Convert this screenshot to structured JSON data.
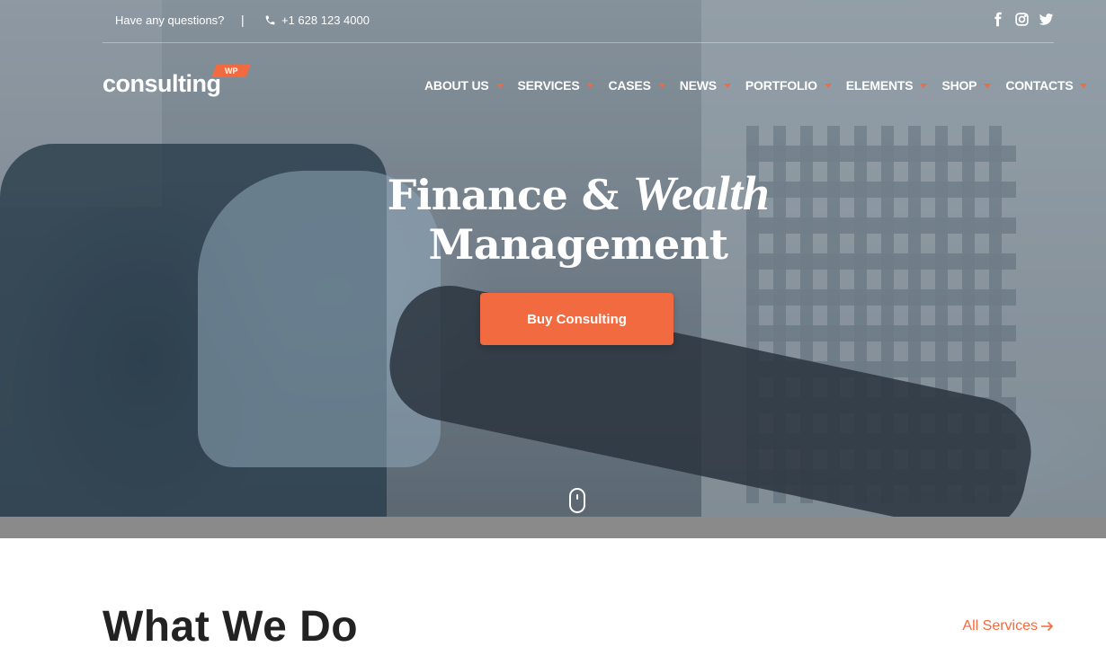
{
  "topbar": {
    "question": "Have any questions?",
    "separator": "|",
    "phone": "+1 628 123 4000",
    "social": [
      "facebook-icon",
      "instagram-icon",
      "twitter-icon"
    ]
  },
  "logo": {
    "text": "consulting",
    "badge": "WP"
  },
  "nav": {
    "items": [
      {
        "label": "ABOUT US"
      },
      {
        "label": "SERVICES"
      },
      {
        "label": "CASES"
      },
      {
        "label": "NEWS"
      },
      {
        "label": "PORTFOLIO"
      },
      {
        "label": "ELEMENTS"
      },
      {
        "label": "SHOP"
      },
      {
        "label": "CONTACTS"
      }
    ]
  },
  "hero": {
    "headline_part1": "Finance &",
    "headline_italic": "Wealth",
    "headline_line2": "Management",
    "cta_label": "Buy Consulting"
  },
  "section": {
    "title": "What We Do",
    "link_label": "All Services"
  },
  "colors": {
    "accent": "#f26a3f",
    "text_dark": "#222222",
    "white": "#ffffff"
  }
}
